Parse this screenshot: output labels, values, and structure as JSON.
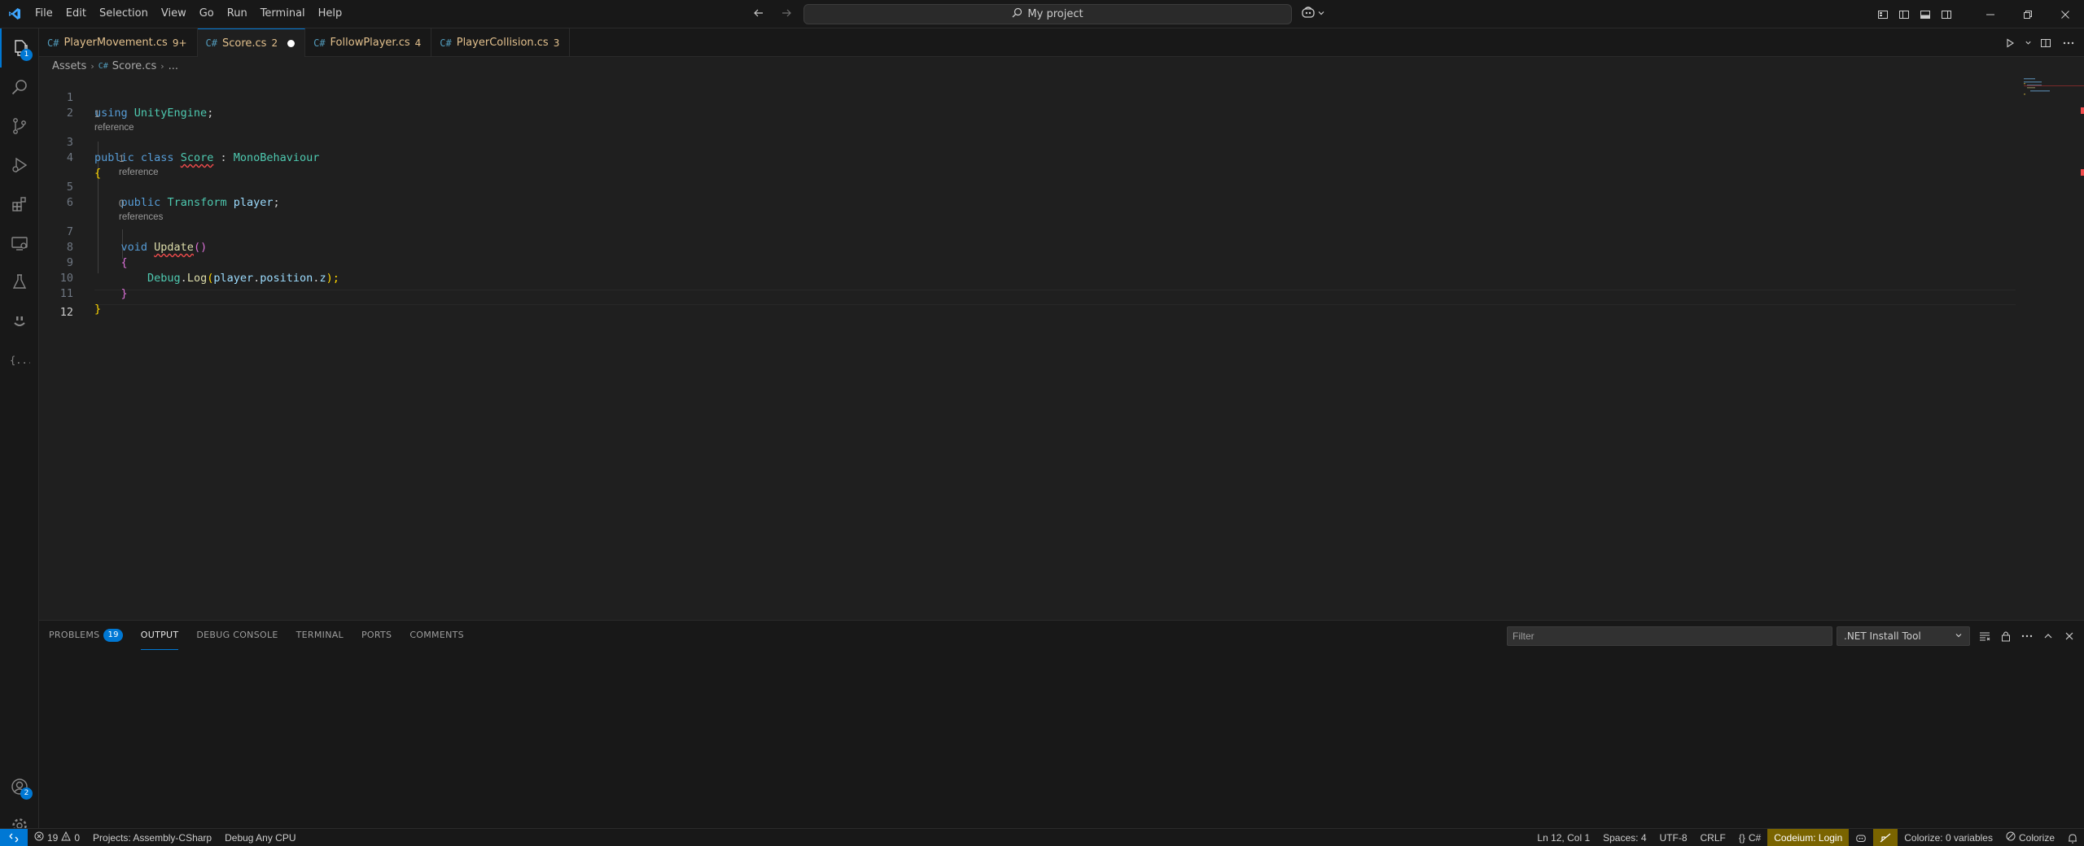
{
  "menu": [
    "File",
    "Edit",
    "Selection",
    "View",
    "Go",
    "Run",
    "Terminal",
    "Help"
  ],
  "command_center": {
    "label": "My project"
  },
  "activity": {
    "explorer_badge": "1",
    "accounts_badge": "2"
  },
  "tabs": [
    {
      "label": "PlayerMovement.cs",
      "count": "9+",
      "active": false
    },
    {
      "label": "Score.cs",
      "count": "2",
      "active": true,
      "dirty": true
    },
    {
      "label": "FollowPlayer.cs",
      "count": "4",
      "active": false
    },
    {
      "label": "PlayerCollision.cs",
      "count": "3",
      "active": false
    }
  ],
  "breadcrumb": {
    "folder": "Assets",
    "file": "Score.cs",
    "more": "..."
  },
  "editor": {
    "lines": [
      "1",
      "2",
      "3",
      "4",
      "5",
      "6",
      "7",
      "8",
      "9",
      "10",
      "11",
      "12"
    ],
    "lens1": "1 reference",
    "lens2": "1 reference",
    "lens3": "0 references",
    "l1_kw": "using",
    "l1_ty": "UnityEngine",
    "l1_p": ";",
    "l3_kw1": "public",
    "l3_kw2": "class",
    "l3_ty": "Score",
    "l3_p": " : ",
    "l3_base": "MonoBehaviour",
    "l4": "{",
    "l5_kw": "public",
    "l5_ty": "Transform",
    "l5_id": "player",
    "l5_p": ";",
    "l7_kw": "void",
    "l7_fn": "Update",
    "l7_p": "()",
    "l8": "{",
    "l9_ty": "Debug",
    "l9_d1": ".",
    "l9_fn": "Log",
    "l9_o": "(",
    "l9_id1": "player",
    "l9_d2": ".",
    "l9_id2": "position",
    "l9_d3": ".",
    "l9_id3": "z",
    "l9_c": ");",
    "l10": "}",
    "l11": "}"
  },
  "panel": {
    "tabs": [
      "PROBLEMS",
      "OUTPUT",
      "DEBUG CONSOLE",
      "TERMINAL",
      "PORTS",
      "COMMENTS"
    ],
    "problems_badge": "19",
    "active_tab": "OUTPUT",
    "filter_placeholder": "Filter",
    "channel": ".NET Install Tool"
  },
  "status": {
    "errors": "19",
    "warnings": "0",
    "project": "Projects: Assembly-CSharp",
    "debug": "Debug Any CPU",
    "position": "Ln 12, Col 1",
    "spaces": "Spaces: 4",
    "encoding": "UTF-8",
    "eol": "CRLF",
    "language": "C#",
    "codeium": "Codeium: Login",
    "colorize_vars": "Colorize: 0 variables",
    "colorize": "Colorize"
  },
  "colors": {
    "accent": "#0078d4",
    "error": "#f14c4c",
    "warning_bg": "#7a6400"
  }
}
